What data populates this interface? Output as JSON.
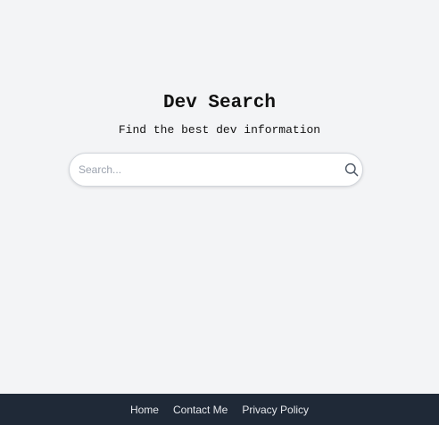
{
  "header": {
    "title": "Dev Search",
    "subtitle": "Find the best dev information"
  },
  "search": {
    "placeholder": "Search...",
    "value": "",
    "icon": "search-icon"
  },
  "footer": {
    "links": [
      {
        "label": "Home"
      },
      {
        "label": "Contact Me"
      },
      {
        "label": "Privacy Policy"
      }
    ]
  },
  "colors": {
    "background": "#f3f4f6",
    "footer": "#1f2937",
    "footer_text": "#e5e7eb",
    "text": "#111111",
    "placeholder": "#9ca3af"
  }
}
